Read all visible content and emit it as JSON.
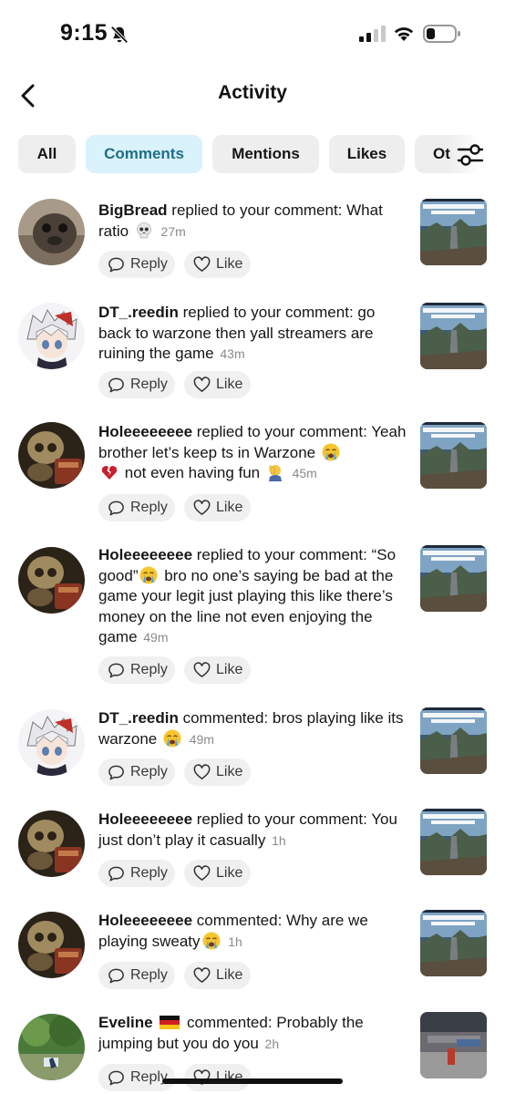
{
  "status_bar": {
    "time": "9:15",
    "icons": [
      "bell-off-icon",
      "signal-icon",
      "wifi-icon",
      "battery-icon"
    ],
    "battery_level": 0.25
  },
  "header": {
    "title": "Activity",
    "back_icon": "chevron-left-icon"
  },
  "tabs": [
    {
      "label": "All",
      "active": false
    },
    {
      "label": "Comments",
      "active": true
    },
    {
      "label": "Mentions",
      "active": false
    },
    {
      "label": "Likes",
      "active": false
    },
    {
      "label": "Ot",
      "active": false
    }
  ],
  "filter_icon": "sliders-icon",
  "colors": {
    "active_tab_bg": "#d9f2fb",
    "active_tab_text": "#1f6e88",
    "tab_bg": "#eeeeee",
    "time_text": "#8a8a8a"
  },
  "reply_label": "Reply",
  "like_label": "Like",
  "items": [
    {
      "username": "BigBread",
      "action": " replied to your comment: ",
      "text": "What ratio",
      "emoji": "skull",
      "text_after": "",
      "time": "27m",
      "avatar": "seal-photo"
    },
    {
      "username": "DT_.reedin",
      "action": " replied to your comment: ",
      "text": "go back to warzone then yall streamers are ruining the game",
      "emoji": "",
      "text_after": "",
      "time": "43m",
      "avatar": "anime-character"
    },
    {
      "username": "Holeeeeeeee",
      "action": " replied to your comment: ",
      "text": "Yeah brother let’s keep ts in Warzone",
      "emoji": "crying-face",
      "text_after": "not even having fun",
      "time": "45m",
      "avatar": "skull-book"
    },
    {
      "username": "Holeeeeeeee",
      "action": " replied to your comment: ",
      "text": "“So good”",
      "emoji": "crying-face",
      "text_after": "bro no one’s saying be bad at the game your legit just playing this like there’s money on the line not even enjoying the game",
      "time": "49m",
      "avatar": "skull-book"
    },
    {
      "username": "DT_.reedin",
      "action": " commented: ",
      "text": "bros playing like its warzone",
      "emoji": "crying-face",
      "text_after": "",
      "time": "49m",
      "avatar": "anime-character"
    },
    {
      "username": "Holeeeeeeee",
      "action": " replied to your comment: ",
      "text": "You just don’t play it casually",
      "emoji": "",
      "text_after": "",
      "time": "1h",
      "avatar": "skull-book"
    },
    {
      "username": "Holeeeeeeee",
      "action": " commented: ",
      "text": "Why are we playing sweaty",
      "emoji": "crying-face",
      "text_after": "",
      "time": "1h",
      "avatar": "skull-book"
    },
    {
      "username": "Eveline",
      "action": "commented: ",
      "text": "Probably the jumping but you do you",
      "emoji": "",
      "text_after": "",
      "time": "2h",
      "avatar": "nature-photo",
      "flag": "germany-flag"
    }
  ],
  "thumb_text": "HOW TO BREAK A POINT"
}
